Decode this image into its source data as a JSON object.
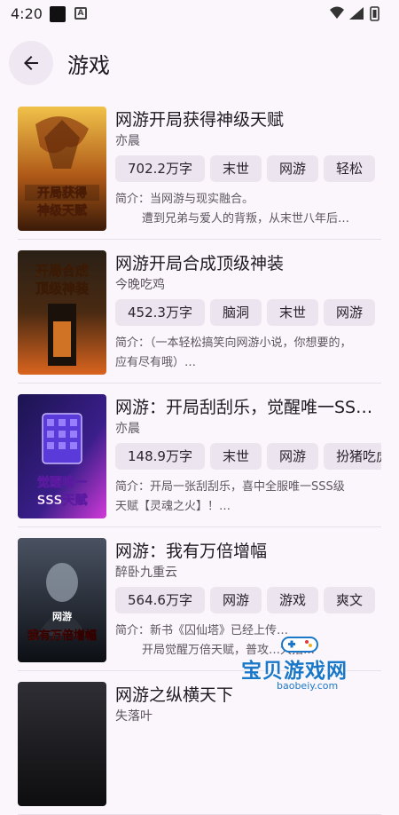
{
  "status_bar": {
    "time": "4:20",
    "a_icon": "A"
  },
  "app_bar": {
    "title": "游戏"
  },
  "books": [
    {
      "title": "网游开局获得神级天赋",
      "author": "亦晨",
      "tags": [
        "702.2万字",
        "末世",
        "网游",
        "轻松"
      ],
      "synopsis": [
        "简介：当网游与现实融合。",
        "遭到兄弟与爱人的背叛，从末世八年后…"
      ],
      "cover_text": [
        "开局获得",
        "神级天赋"
      ],
      "cover_colors": [
        "#d9a23a",
        "#7a3a10"
      ]
    },
    {
      "title": "网游开局合成顶级神装",
      "author": "今晚吃鸡",
      "tags": [
        "452.3万字",
        "脑洞",
        "末世",
        "网游"
      ],
      "synopsis": [
        "简介：（一本轻松搞笑向网游小说，你想要的，",
        "应有尽有哦）…"
      ],
      "cover_text": [
        "开局合成",
        "顶级神装"
      ],
      "cover_colors": [
        "#3a2a18",
        "#c2551a"
      ]
    },
    {
      "title": "网游：开局刮刮乐，觉醒唯一SSS级天赋",
      "author": "亦晨",
      "tags": [
        "148.9万字",
        "末世",
        "网游",
        "扮猪吃虎"
      ],
      "synopsis": [
        "简介：开局一张刮刮乐，喜中全服唯一SSS级",
        "天赋【灵魂之火】！…"
      ],
      "cover_text": [
        "觉醒唯一",
        "SSS天赋"
      ],
      "cover_colors": [
        "#2b1f7a",
        "#c23ad0"
      ]
    },
    {
      "title": "网游：我有万倍增幅",
      "author": "醉卧九重云",
      "tags": [
        "564.6万字",
        "网游",
        "游戏",
        "爽文"
      ],
      "synopsis": [
        "简介：新书《囚仙塔》已经上传…",
        "开局觉醒万倍天赋，普攻…大招…"
      ],
      "cover_text": [
        "网游",
        "我有万倍增幅"
      ],
      "cover_colors": [
        "#3a4150",
        "#0e1116"
      ]
    },
    {
      "title": "网游之纵横天下",
      "author": "失落叶",
      "tags": [],
      "synopsis": [],
      "cover_text": [],
      "cover_colors": [
        "#2a2a2e",
        "#101012"
      ]
    }
  ],
  "watermark": {
    "text": "宝贝游戏网",
    "url": "baobeiy.com"
  },
  "theme": {
    "background": "#fbf6fc",
    "chip_bg": "#ece5ef",
    "watermark_blue": "#1b78c8"
  }
}
